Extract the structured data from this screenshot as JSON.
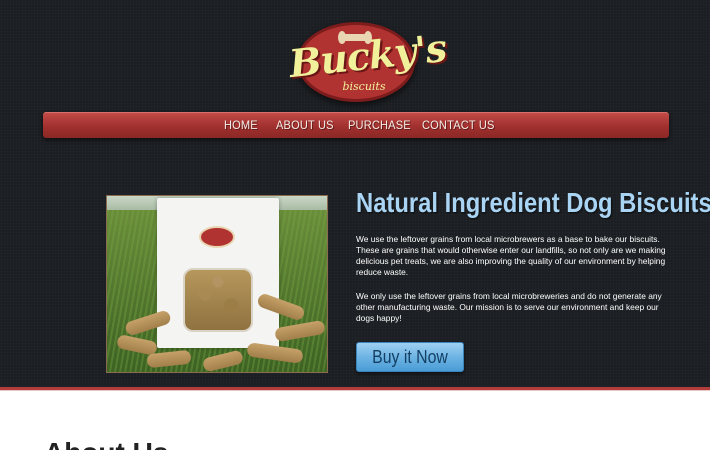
{
  "brand": {
    "name": "Bucky's",
    "tagline": "biscuits",
    "colors": {
      "accent": "#b13331",
      "logo_text": "#f1f19b",
      "headline": "#a9d4f4",
      "button": "#6db4e4"
    }
  },
  "nav": {
    "items": [
      {
        "label": "HOME"
      },
      {
        "label": "ABOUT US"
      },
      {
        "label": "PURCHASE"
      },
      {
        "label": "CONTACT US"
      }
    ]
  },
  "hero": {
    "image_alt_icon": "dog-biscuit-bag-photo",
    "headline": "Natural Ingredient Dog Biscuits!",
    "paragraphs": [
      "We use the leftover grains from local microbrewers as a base to bake our biscuits. These are grains that would otherwise enter our landfills, so not only are we making delicious pet treats, we are also improving the quality of our environment by helping reduce waste.",
      "We only use the leftover grains from local microbreweries and do not generate any other manufacturing waste. Our mission is to serve our environment and keep our dogs happy!"
    ],
    "cta_label": "Buy it Now"
  },
  "about": {
    "heading": "About Us"
  }
}
